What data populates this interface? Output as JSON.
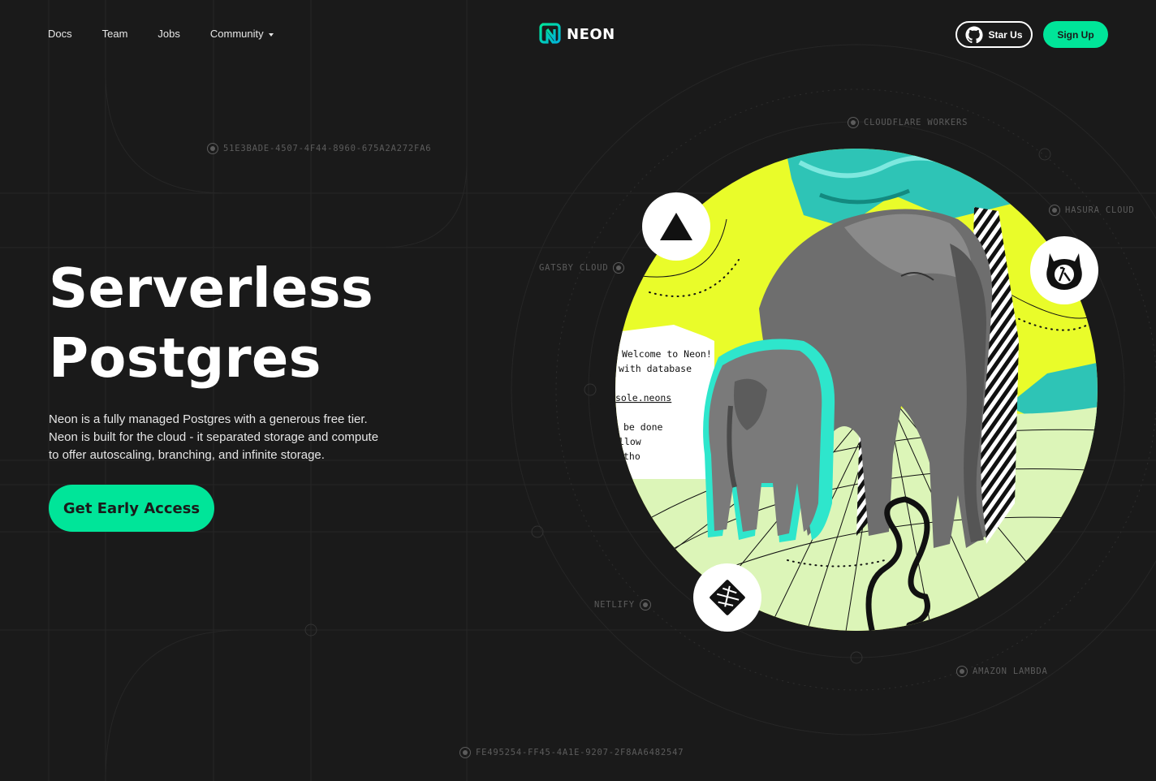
{
  "nav": {
    "items": [
      {
        "label": "Docs"
      },
      {
        "label": "Team"
      },
      {
        "label": "Jobs"
      },
      {
        "label": "Community"
      }
    ]
  },
  "brand": {
    "name": "NEON"
  },
  "header": {
    "star_label": "Star Us",
    "signup_label": "Sign Up"
  },
  "hero": {
    "title_line1": "Serverless",
    "title_line2": "Postgres",
    "desc_line1": "Neon is a fully managed Postgres with a generous free tier.",
    "desc_line2": "Neon is built for the cloud - it separated storage and compute",
    "desc_line3": "to offer autoscaling, branching, and infinite storage.",
    "cta_label": "Get Early Access"
  },
  "labels": {
    "uuid_top": "51E3BADE-4507-4F44-8960-675A2A272FA6",
    "uuid_bottom": "FE495254-FF45-4A1E-9207-2F8AA6482547",
    "cloudflare": "CLOUDFLARE WORKERS",
    "hasura": "HASURA CLOUD",
    "gatsby": "GATSBY CLOUD",
    "netlify": "NETLIFY",
    "lambda": "AMAZON LAMBDA"
  },
  "terminal": {
    "line1": "Welcome to Neon!",
    "line2": "with database",
    "line3": "sole.neons",
    "line4": "be done",
    "line5": "llow",
    "line6": "tho"
  },
  "icons": {
    "vercel": "triangle-icon",
    "hasura": "hasura-icon",
    "netlify": "netlify-icon",
    "github": "github-icon"
  },
  "colors": {
    "background": "#1a1a1a",
    "accent": "#00e599",
    "lime": "#e9fc2a",
    "teal": "#2ec4b6"
  }
}
